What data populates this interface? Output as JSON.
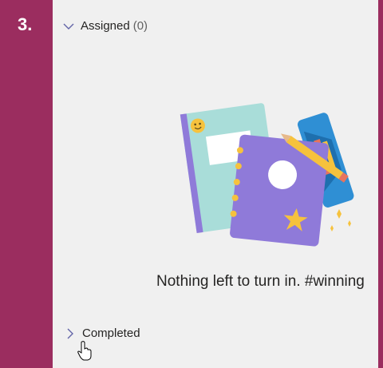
{
  "step": {
    "number": "3."
  },
  "assigned": {
    "label": "Assigned",
    "count": "(0)",
    "expanded": true,
    "chevron_icon": "chevron-down-icon"
  },
  "empty_state": {
    "message": "Nothing left to turn in. #winning",
    "illustration": "notebooks-pencils-illustration"
  },
  "completed": {
    "label": "Completed",
    "expanded": false,
    "chevron_icon": "chevron-right-icon"
  },
  "cursor": {
    "icon": "hand-pointer-icon"
  },
  "colors": {
    "frame": "#9b2d5f",
    "panel": "#f0f0f0",
    "chevron": "#6264a7",
    "notebook_teal": "#a9ddd9",
    "notebook_purple": "#8f7ad9",
    "star_yellow": "#f6c23d"
  }
}
